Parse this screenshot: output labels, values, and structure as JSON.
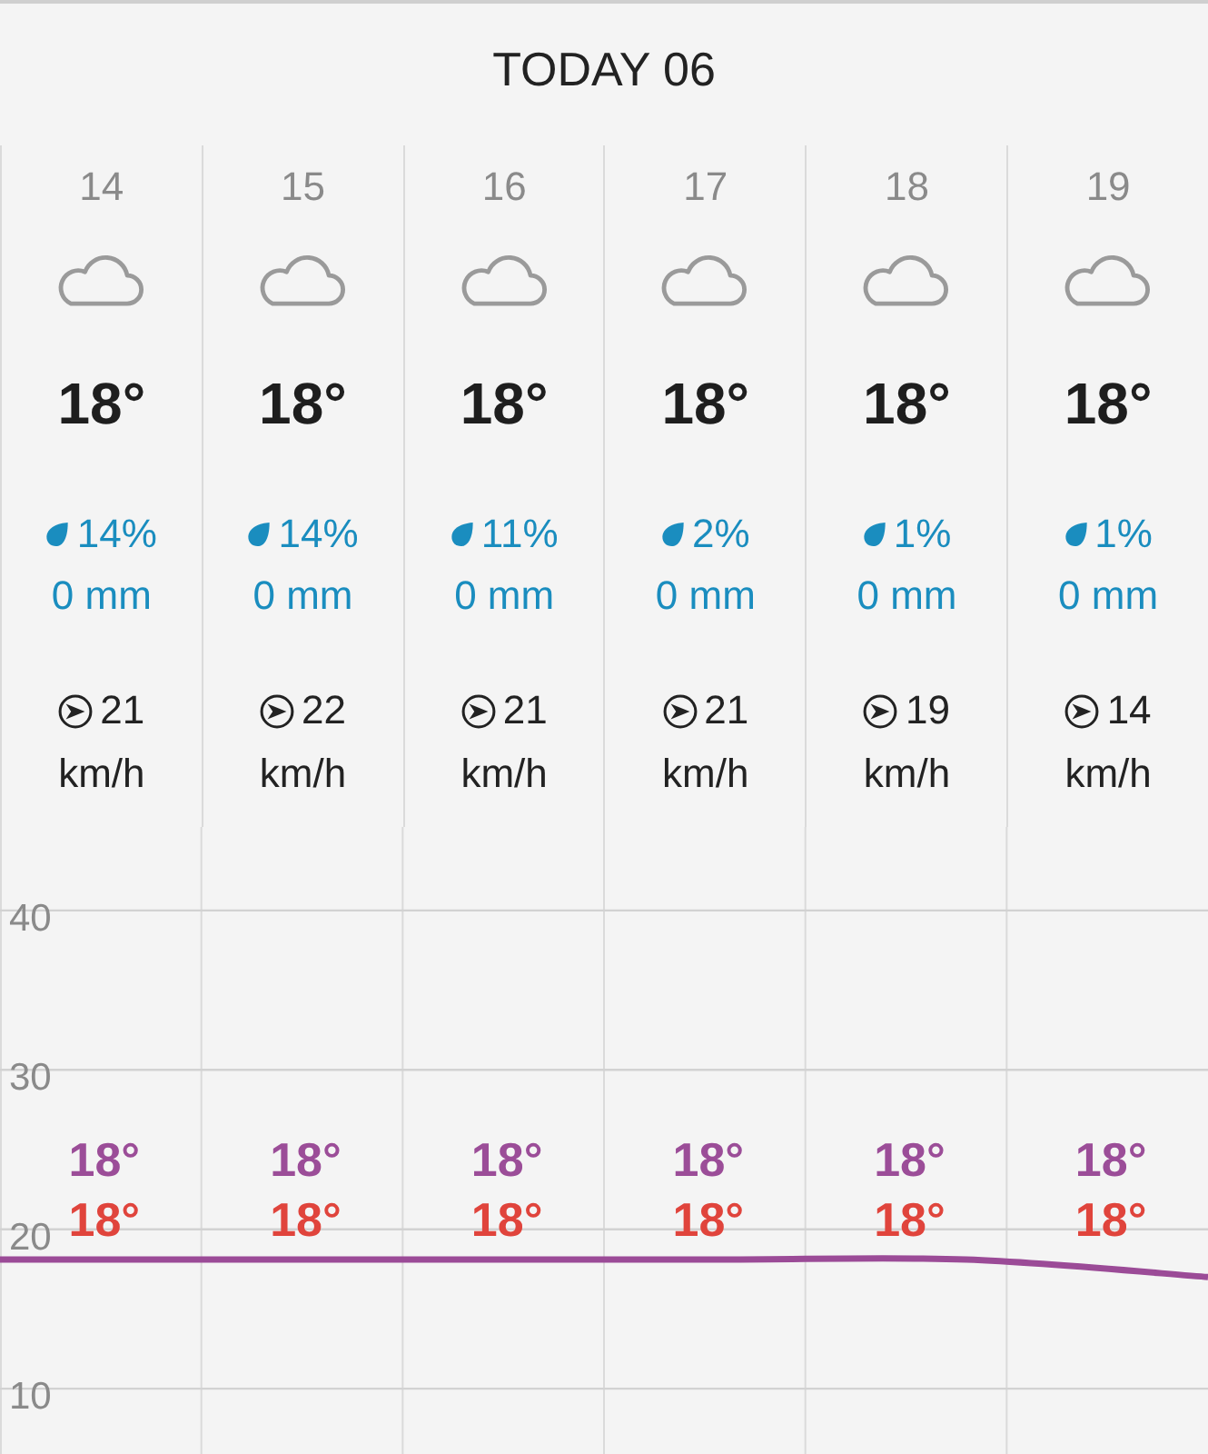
{
  "header": {
    "title": "TODAY 06"
  },
  "hours": [
    {
      "hour": "14",
      "temperature": "18°",
      "rain_chance": "14%",
      "rain_amount": "0 mm",
      "wind_speed": "21",
      "wind_unit": "km/h"
    },
    {
      "hour": "15",
      "temperature": "18°",
      "rain_chance": "14%",
      "rain_amount": "0 mm",
      "wind_speed": "22",
      "wind_unit": "km/h"
    },
    {
      "hour": "16",
      "temperature": "18°",
      "rain_chance": "11%",
      "rain_amount": "0 mm",
      "wind_speed": "21",
      "wind_unit": "km/h"
    },
    {
      "hour": "17",
      "temperature": "18°",
      "rain_chance": "2%",
      "rain_amount": "0 mm",
      "wind_speed": "21",
      "wind_unit": "km/h"
    },
    {
      "hour": "18",
      "temperature": "18°",
      "rain_chance": "1%",
      "rain_amount": "0 mm",
      "wind_speed": "19",
      "wind_unit": "km/h"
    },
    {
      "hour": "19",
      "temperature": "18°",
      "rain_chance": "1%",
      "rain_amount": "0 mm",
      "wind_speed": "14",
      "wind_unit": "km/h"
    }
  ],
  "chart": {
    "label_rows": [
      {
        "color": "#9b4d98",
        "labels": [
          "18°",
          "18°",
          "18°",
          "18°",
          "18°",
          "18°"
        ]
      },
      {
        "color": "#e0443c",
        "labels": [
          "18°",
          "18°",
          "18°",
          "18°",
          "18°",
          "18°"
        ]
      }
    ],
    "chart_data": {
      "type": "line",
      "ylim": [
        5.9,
        88
      ],
      "yticks": [
        10,
        20,
        30,
        40
      ],
      "grid": true,
      "series": [
        {
          "color": "#9b4b97",
          "values": [
            18.1,
            18.1,
            18.1,
            18.1,
            18.1,
            17.0
          ]
        }
      ]
    }
  }
}
